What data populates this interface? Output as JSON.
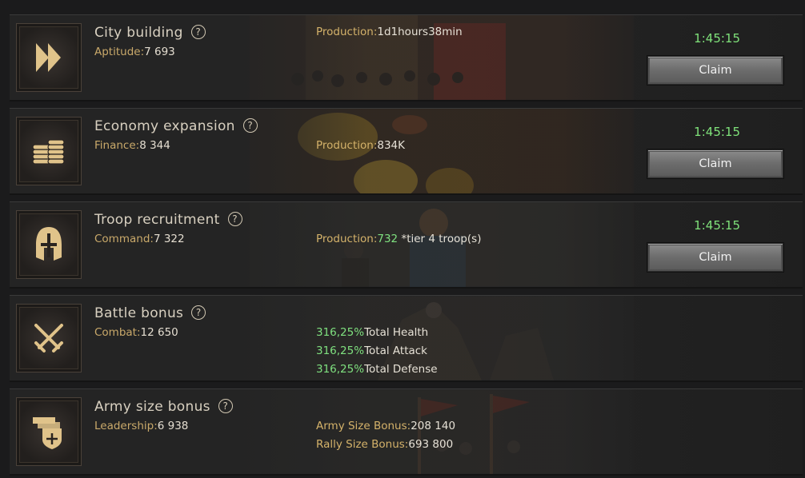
{
  "rows": [
    {
      "title": "City building",
      "help_icon": "?",
      "stat_label": "Aptitude:",
      "stat_value": "7 693",
      "prod_label": "Production:",
      "prod_value": "1d1hours38min",
      "timer": "1:45:15",
      "claim_label": "Claim"
    },
    {
      "title": "Economy expansion",
      "help_icon": "?",
      "stat_label": "Finance:",
      "stat_value": "8 344",
      "prod_label": "Production:",
      "prod_value": "834K",
      "timer": "1:45:15",
      "claim_label": "Claim"
    },
    {
      "title": "Troop recruitment",
      "help_icon": "?",
      "stat_label": "Command:",
      "stat_value": "7 322",
      "prod_label": "Production:",
      "prod_value": "732",
      "prod_suffix": " *tier 4 troop(s)",
      "timer": "1:45:15",
      "claim_label": "Claim"
    },
    {
      "title": "Battle bonus",
      "help_icon": "?",
      "stat_label": "Combat:",
      "stat_value": "12 650",
      "bonuses": [
        {
          "value": "316,25%",
          "label": "Total Health"
        },
        {
          "value": "316,25%",
          "label": "Total Attack"
        },
        {
          "value": "316,25%",
          "label": "Total Defense"
        }
      ]
    },
    {
      "title": "Army size bonus",
      "help_icon": "?",
      "stat_label": "Leadership:",
      "stat_value": "6 938",
      "sizes": [
        {
          "label": "Army Size Bonus:",
          "value": "208 140"
        },
        {
          "label": "Rally Size Bonus:",
          "value": "693 800"
        }
      ]
    }
  ],
  "icons": [
    "fast-forward-icon",
    "coins-icon",
    "helmet-icon",
    "crossed-swords-icon",
    "banner-shield-icon"
  ],
  "colors": {
    "gold": "#d4b26a",
    "green": "#7fe07f",
    "timer": "#7fe27a",
    "title": "#d8d0c0"
  }
}
